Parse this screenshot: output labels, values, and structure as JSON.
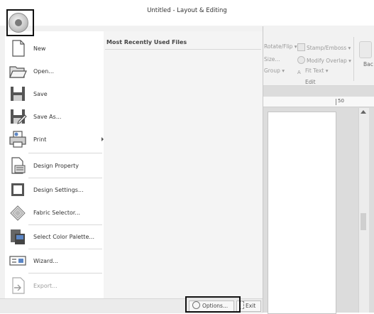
{
  "window": {
    "title": "Untitled - Layout & Editing"
  },
  "ribbon": {
    "rotate_flip": "Rotate/Flip ▾",
    "stamp_emboss": "Stamp/Emboss ▾",
    "size": "Size...",
    "modify_overlap": "Modify Overlap ▾",
    "group": "Group ▾",
    "fit_text": "Fit Text ▾",
    "group_label": "Edit",
    "bac": "Bac"
  },
  "ruler": {
    "tick_label": "50"
  },
  "app_menu": {
    "mru_title": "Most Recently Used Files",
    "items": [
      {
        "label": "New",
        "icon": "new-document-icon"
      },
      {
        "label": "Open...",
        "icon": "open-folder-icon"
      },
      {
        "label": "Save",
        "icon": "save-icon"
      },
      {
        "label": "Save As...",
        "icon": "save-as-icon"
      },
      {
        "label": "Print",
        "icon": "print-icon"
      },
      {
        "label": "Design Property",
        "icon": "design-property-icon"
      },
      {
        "label": "Design Settings...",
        "icon": "design-settings-icon"
      },
      {
        "label": "Fabric Selector...",
        "icon": "fabric-selector-icon"
      },
      {
        "label": "Select Color Palette...",
        "icon": "color-palette-icon"
      },
      {
        "label": "Wizard...",
        "icon": "wizard-icon"
      },
      {
        "label": "Export...",
        "icon": "export-icon"
      }
    ],
    "options_label": "Options...",
    "exit_label": "Exit"
  },
  "colors": {
    "highlight": "#111111",
    "menu_bg": "#f1f1f1",
    "accent_blue": "#5b86c5"
  }
}
